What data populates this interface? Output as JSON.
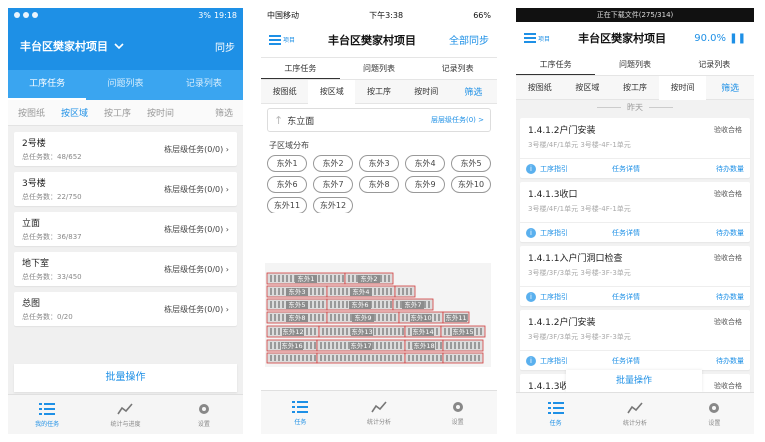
{
  "screen1": {
    "status": {
      "time": "19:18",
      "battery": "3%"
    },
    "header": {
      "title": "丰台区樊家村项目",
      "sync": "同步"
    },
    "tabs": [
      "工序任务",
      "问题列表",
      "记录列表"
    ],
    "filters": [
      "按图纸",
      "按区域",
      "按工序",
      "按时间",
      "筛选"
    ],
    "items": [
      {
        "name": "2号楼",
        "count": "总任务数：48/652",
        "sub": "栋层级任务(0/0)"
      },
      {
        "name": "3号楼",
        "count": "总任务数：22/750",
        "sub": "栋层级任务(0/0)"
      },
      {
        "name": "立面",
        "count": "总任务数：36/837",
        "sub": "栋层级任务(0/0)"
      },
      {
        "name": "地下室",
        "count": "总任务数：33/450",
        "sub": "栋层级任务(0/0)"
      },
      {
        "name": "总图",
        "count": "总任务数：0/20",
        "sub": "栋层级任务(0/0)"
      }
    ],
    "batch": "批量操作",
    "bottom_nav": [
      "我的任务",
      "统计与进度",
      "设置"
    ]
  },
  "screen2": {
    "status": {
      "carrier": "中国移动",
      "time": "下午3:38",
      "battery": "66%"
    },
    "header": {
      "menu_label": "项目",
      "title": "丰台区樊家村项目",
      "right": "全部同步"
    },
    "tabs": [
      "工序任务",
      "问题列表",
      "记录列表"
    ],
    "filters": [
      "按图纸",
      "按区域",
      "按工序",
      "按时间",
      "筛选"
    ],
    "path": {
      "name": "东立面",
      "link": "层层级任务(0) >"
    },
    "section_label": "子区域分布",
    "chips": [
      "东外1",
      "东外2",
      "东外3",
      "东外4",
      "东外5",
      "东外6",
      "东外7",
      "东外8",
      "东外9",
      "东外10",
      "东外11",
      "东外12"
    ],
    "drawing_labels": [
      "东外1",
      "东外2",
      "东外3",
      "东外4",
      "东外5",
      "东外6",
      "东外7",
      "东外8",
      "东外9",
      "东外10",
      "东外11",
      "东外12",
      "东外13",
      "东外14",
      "东外15",
      "东外16",
      "东外17",
      "东外18"
    ],
    "bottom_nav": [
      "任务",
      "统计分析",
      "设置"
    ]
  },
  "screen3": {
    "status": "正在下载文件(275/314)",
    "header": {
      "menu_label": "项目",
      "title": "丰台区樊家村项目",
      "right": "90.0%"
    },
    "tabs": [
      "工序任务",
      "问题列表",
      "记录列表"
    ],
    "filters": [
      "按图纸",
      "按区域",
      "按工序",
      "按时间",
      "筛选"
    ],
    "day_label": "昨天",
    "cards": [
      {
        "title": "1.4.1.2户门安装",
        "status": "验收合格",
        "location": "3号楼/4F/1单元  3号楼-4F-1单元",
        "actions": [
          "工序指引",
          "任务详情",
          "待办数量"
        ]
      },
      {
        "title": "1.4.1.3收口",
        "status": "验收合格",
        "location": "3号楼/4F/1单元  3号楼-4F-1单元",
        "actions": [
          "工序指引",
          "任务详情",
          "待办数量"
        ]
      },
      {
        "title": "1.4.1.1入户门洞口检查",
        "status": "验收合格",
        "location": "3号楼/3F/3单元  3号楼-3F-3单元",
        "actions": [
          "工序指引",
          "任务详情",
          "待办数量"
        ]
      },
      {
        "title": "1.4.1.2户门安装",
        "status": "验收合格",
        "location": "3号楼/3F/3单元  3号楼-3F-3单元",
        "actions": [
          "工序指引",
          "任务详情",
          "待办数量"
        ]
      },
      {
        "title": "1.4.1.3收口",
        "status": "验收合格",
        "location": "",
        "actions": []
      }
    ],
    "batch": "批量操作",
    "bottom_nav": [
      "任务",
      "统计分析",
      "设置"
    ]
  },
  "colors": {
    "primary": "#1e90e6",
    "tab_bar": "#3aa5f0",
    "drawing_line": "#d23b3b"
  }
}
